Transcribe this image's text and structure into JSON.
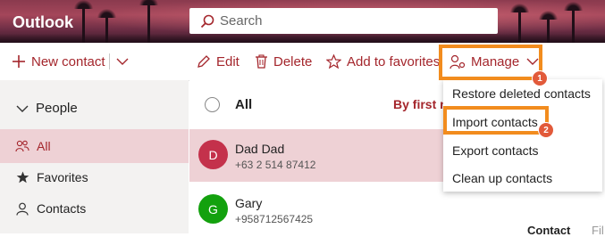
{
  "header": {
    "app_title": "Outlook",
    "search_placeholder": "Search"
  },
  "toolbar": {
    "new_contact": "New contact",
    "edit": "Edit",
    "delete": "Delete",
    "add_to_favorites": "Add to favorites",
    "manage": "Manage"
  },
  "sidebar": {
    "section": "People",
    "items": [
      {
        "label": "All",
        "icon": "people-icon",
        "active": true
      },
      {
        "label": "Favorites",
        "icon": "star-icon",
        "active": false
      },
      {
        "label": "Contacts",
        "icon": "person-icon",
        "active": false
      }
    ]
  },
  "list": {
    "header_label": "All",
    "sort_label": "By first n",
    "contacts": [
      {
        "initial": "D",
        "name": "Dad Dad",
        "phone": "+63 2 514 87412",
        "avatar_color": "#c4314b",
        "selected": true
      },
      {
        "initial": "G",
        "name": "Gary",
        "phone": "+958712567425",
        "avatar_color": "#13a10e",
        "selected": false
      }
    ]
  },
  "details": {
    "tab_contact": "Contact",
    "tab_files": "Fil"
  },
  "manage_menu": {
    "items": [
      "Restore deleted contacts",
      "Import contacts",
      "Export contacts",
      "Clean up contacts"
    ]
  },
  "callouts": {
    "step1": "1",
    "step2": "2"
  },
  "colors": {
    "accent": "#a4262c",
    "highlight": "#f28c1e",
    "selected_bg": "#eed1d5"
  }
}
